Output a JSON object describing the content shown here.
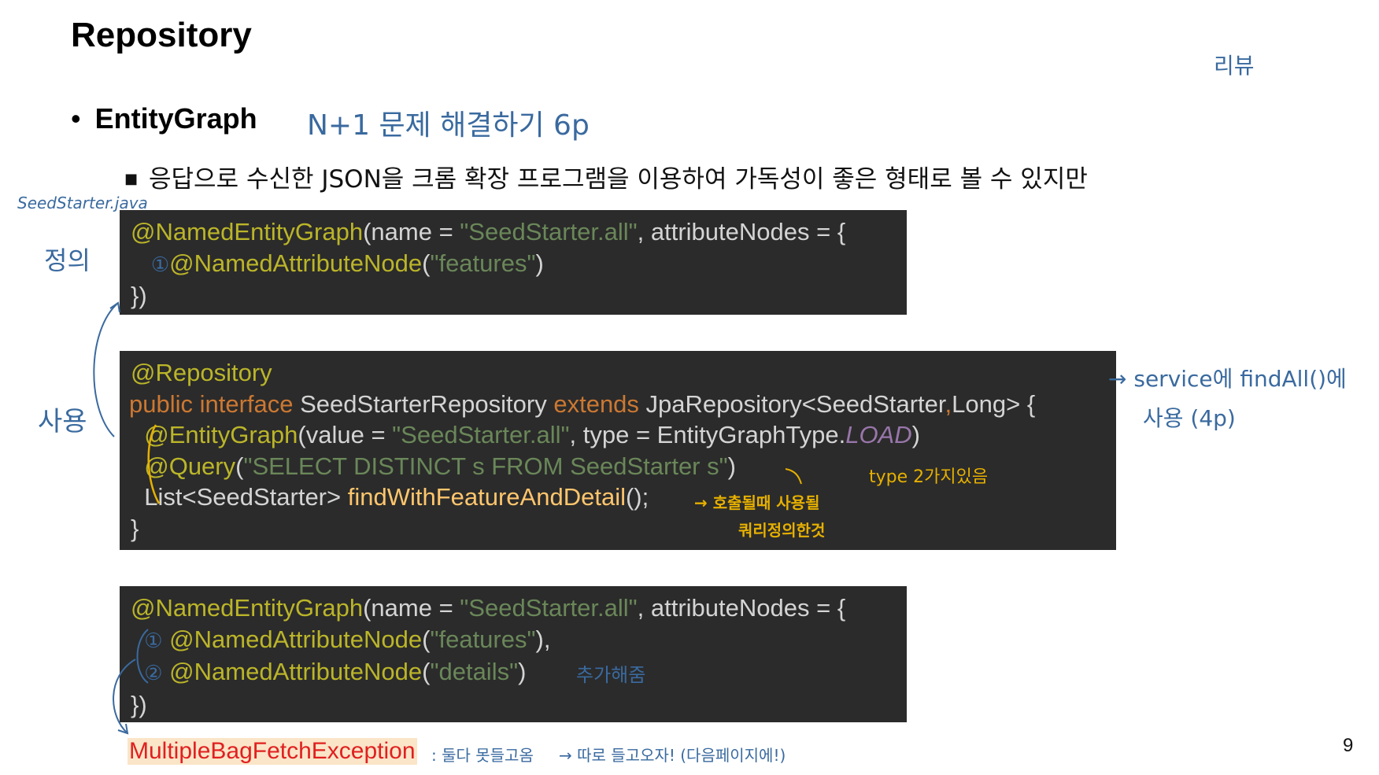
{
  "slide": {
    "title": "Repository",
    "bullet1": "EntityGraph",
    "bullet2": "응답으로 수신한 JSON을 크롬 확장 프로그램을 이용하여 가독성이 좋은 형태로 볼 수 있지만",
    "page_number": "9"
  },
  "code1": {
    "l1_ann": "@NamedEntityGraph",
    "l1_a": "(name = ",
    "l1_str": "\"SeedStarter.all\"",
    "l1_b": ", attributeNodes = {",
    "l2_mark": "①",
    "l2_ann": "@NamedAttributeNode",
    "l2_a": "(",
    "l2_str": "\"features\"",
    "l2_b": ")",
    "l3": "})"
  },
  "code2": {
    "l1_ann": "@Repository",
    "l2_kw1": "public interface ",
    "l2_name": "SeedStarterRepository ",
    "l2_kw2": "extends ",
    "l2_type": "JpaRepository<SeedStarter",
    "l2_comma": ",",
    "l2_rest": "Long> {",
    "l3_ann": "@EntityGraph",
    "l3_a": "(value = ",
    "l3_str": "\"SeedStarter.all\"",
    "l3_b": ", type = EntityGraphType.",
    "l3_it": "LOAD",
    "l3_c": ")",
    "l4_ann": "@Query",
    "l4_a": "(",
    "l4_str": "\"SELECT DISTINCT s FROM SeedStarter s\"",
    "l4_b": ")",
    "l5_type": "List<SeedStarter> ",
    "l5_fn": "findWithFeatureAndDetail",
    "l5_a": "();",
    "l6": "}"
  },
  "code3": {
    "l1_ann": "@NamedEntityGraph",
    "l1_a": "(name = ",
    "l1_str": "\"SeedStarter.all\"",
    "l1_b": ", attributeNodes = {",
    "l2_mark": "①",
    "l2_ann": "@NamedAttributeNode",
    "l2_a": "(",
    "l2_str": "\"features\"",
    "l2_b": "),",
    "l3_mark": "②",
    "l3_ann": "@NamedAttributeNode",
    "l3_a": "(",
    "l3_str": "\"details\"",
    "l3_b": ")",
    "l4": "})"
  },
  "exception": "MultipleBagFetchException",
  "handwriting": {
    "top_right": "리뷰",
    "n_plus_one": "N+1 문제 해결하기 6p",
    "file": "SeedStarter.java",
    "define": "정의",
    "use": "사용",
    "service": "→ service에 findAll()에",
    "service2": "사용 (4p)",
    "type_note": "type 2가지있음",
    "called1": "→ 호출될때 사용될",
    "called2": "쿼리정의한것",
    "add": "추가해줌",
    "exc_note1": ": 둘다 못들고옴",
    "exc_note2": "→ 따로 들고오자! (다음페이지에!)"
  },
  "colors": {
    "code_bg": "#2b2b2b",
    "annotation": "#bbb529",
    "string": "#6a8759",
    "keyword": "#cc7832",
    "function": "#ffc66d",
    "handwriting_blue": "#3a6a9f",
    "handwriting_orange": "#e6b000",
    "exception_red": "#e02020"
  }
}
